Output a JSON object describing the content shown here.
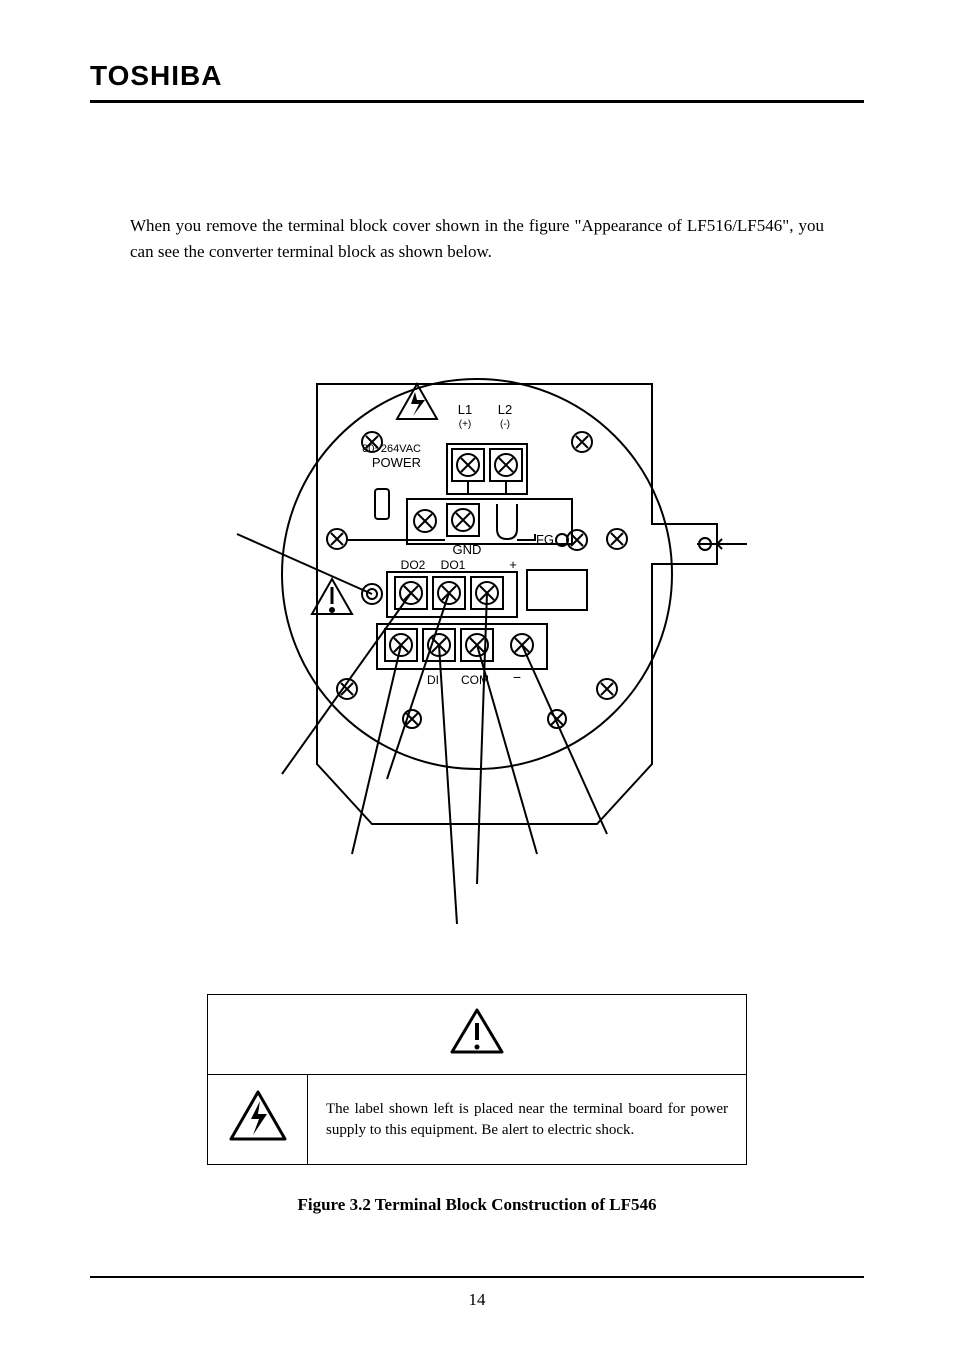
{
  "header": {
    "logo": "TOSHIBA",
    "right": ""
  },
  "intro": "When you remove the terminal block cover shown in the figure \"Appearance of LF516/LF546\", you can see the converter terminal block as shown below.",
  "diagram": {
    "labels": {
      "power_range": "80~264VAC",
      "power": "POWER",
      "l1": "L1",
      "l1_sign": "(+)",
      "l2": "L2",
      "l2_sign": "(-)",
      "gnd": "GND",
      "fg": "FG",
      "do2": "DO2",
      "do1": "DO1",
      "plus": "+",
      "di": "DI",
      "com": "COM",
      "minus": "−"
    }
  },
  "warning": {
    "text": "The label shown left is placed near the terminal board for power supply to this equipment.\nBe alert to electric shock."
  },
  "caption": "Figure 3.2    Terminal Block Construction of LF546",
  "page_number": "14"
}
